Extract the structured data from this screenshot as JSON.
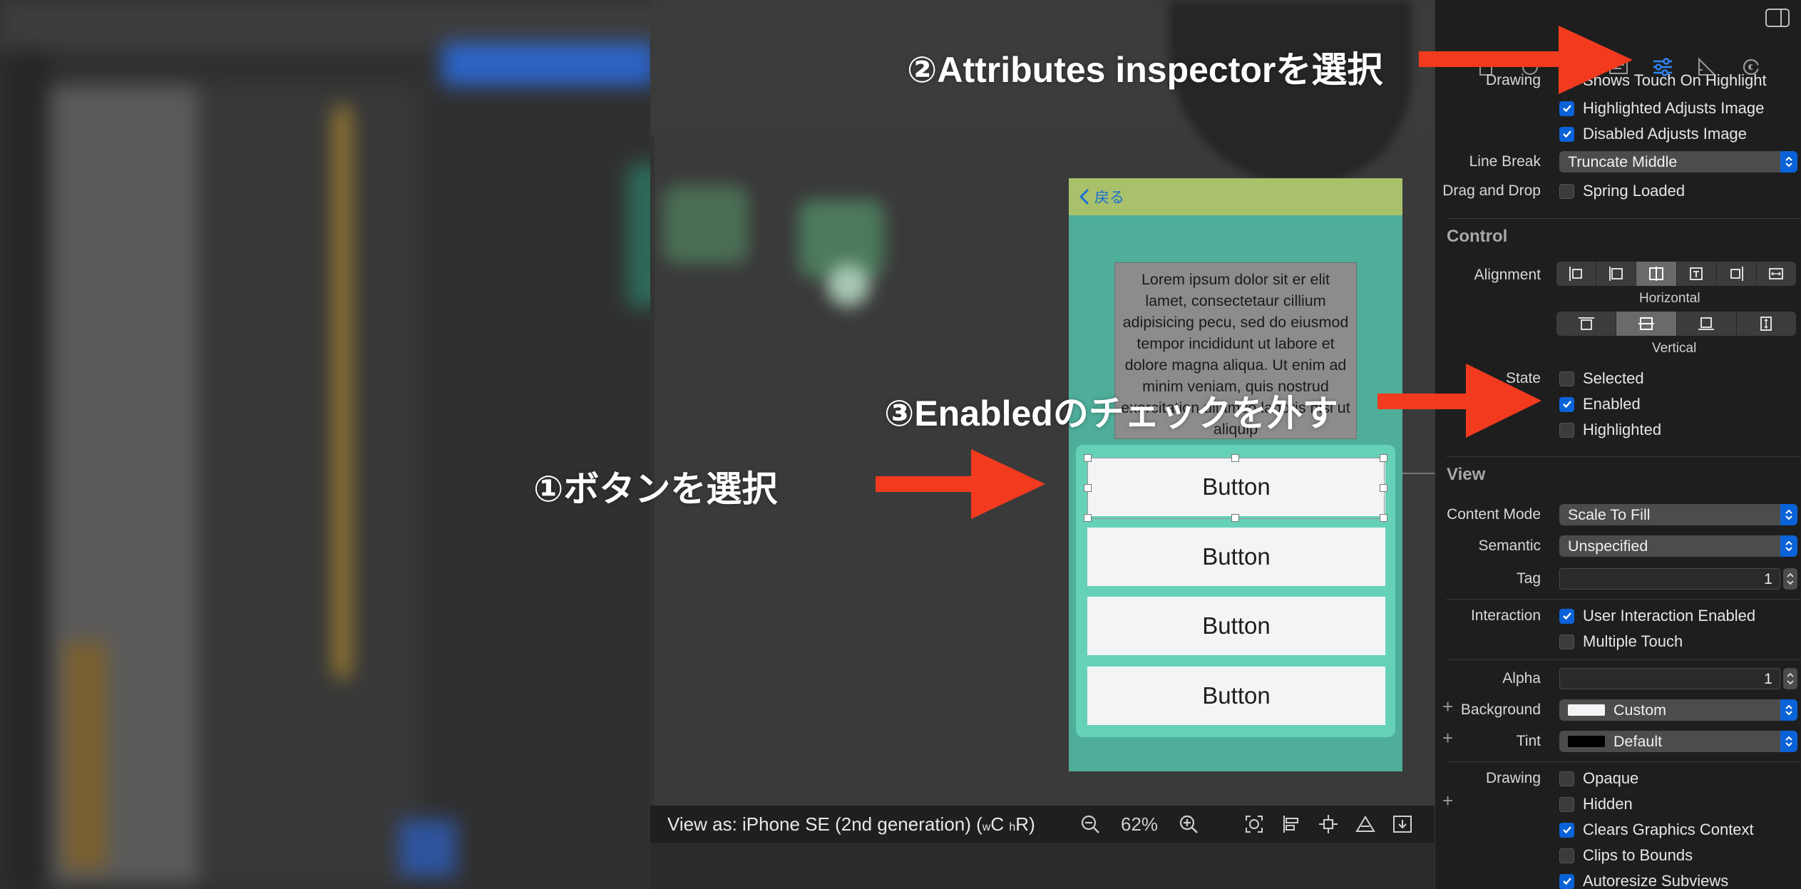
{
  "annotations": {
    "step1": "①ボタンを選択",
    "step2": "②Attributes inspectorを選択",
    "step3": "③Enabledのチェックを外す",
    "arrow_color": "#f23a1f"
  },
  "phone": {
    "back_label": "戻る",
    "lorem": "Lorem ipsum dolor sit er elit lamet, consectetaur cillium adipisicing pecu, sed do eiusmod tempor incididunt ut labore et dolore magna aliqua. Ut enim ad minim veniam, quis nostrud exercitation ullamco laboris nisi ut aliquip",
    "buttons": [
      "Button",
      "Button",
      "Button",
      "Button"
    ],
    "nav_color": "#a9c16b",
    "bg_color": "#4fae9a",
    "stack_color": "#65d2b8"
  },
  "bottom_bar": {
    "view_as_prefix": "View as: iPhone SE (2nd generation) (",
    "size_w": "w",
    "size_c": "C",
    "size_h": "h",
    "size_r": "R",
    "view_as_suffix": ")",
    "zoom": "62%"
  },
  "inspector": {
    "drawing_top_label": "Drawing",
    "shows_touch": "Shows Touch On Highlight",
    "highlighted_adjusts": "Highlighted Adjusts Image",
    "disabled_adjusts": "Disabled Adjusts Image",
    "line_break_label": "Line Break",
    "line_break_value": "Truncate Middle",
    "drag_drop_label": "Drag and Drop",
    "spring_loaded": "Spring Loaded",
    "control_section": "Control",
    "alignment_label": "Alignment",
    "horizontal_caption": "Horizontal",
    "vertical_caption": "Vertical",
    "state_label": "State",
    "state_selected": "Selected",
    "state_enabled": "Enabled",
    "state_highlighted": "Highlighted",
    "view_section": "View",
    "content_mode_label": "Content Mode",
    "content_mode_value": "Scale To Fill",
    "semantic_label": "Semantic",
    "semantic_value": "Unspecified",
    "tag_label": "Tag",
    "tag_value": "1",
    "interaction_label": "Interaction",
    "user_interaction": "User Interaction Enabled",
    "multiple_touch": "Multiple Touch",
    "alpha_label": "Alpha",
    "alpha_value": "1",
    "background_label": "Background",
    "background_value": "Custom",
    "tint_label": "Tint",
    "tint_value": "Default",
    "drawing_label": "Drawing",
    "opaque": "Opaque",
    "hidden": "Hidden",
    "clears_graphics": "Clears Graphics Context",
    "clips_bounds": "Clips to Bounds",
    "autoresize": "Autoresize Subviews",
    "accent_color": "#0a62d8"
  }
}
